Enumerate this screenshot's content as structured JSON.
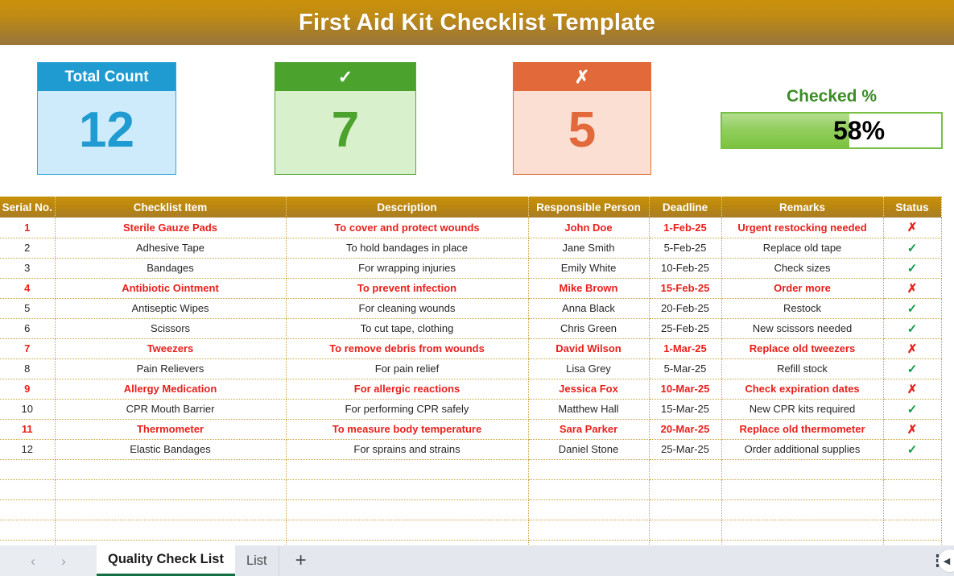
{
  "document": {
    "title": "First Aid Kit Checklist Template"
  },
  "kpis": [
    {
      "id": "total",
      "header_label": "Total Count",
      "header_icon": "",
      "value": "12",
      "accent": "#1f9bd1",
      "body_bg": "#cdebfa"
    },
    {
      "id": "checked",
      "header_label": "✓",
      "header_icon": "check-icon",
      "value": "7",
      "accent": "#4ba32e",
      "body_bg": "#d9f0cd"
    },
    {
      "id": "unchecked",
      "header_label": "✗",
      "header_icon": "cross-icon",
      "value": "5",
      "accent": "#e2693a",
      "body_bg": "#fbdfd2"
    }
  ],
  "gauge": {
    "label": "Checked %",
    "value_text": "58%",
    "percent": 58,
    "accent": "#77c043",
    "label_color": "#3d8b28"
  },
  "table": {
    "columns": [
      "Serial No.",
      "Checklist Item",
      "Description",
      "Responsible Person",
      "Deadline",
      "Remarks",
      "Status"
    ],
    "header_bg": "#c9910b",
    "alert_color": "#e8201c",
    "ok_color": "#0f9d49",
    "rows": [
      {
        "serial": "1",
        "item": "Sterile Gauze Pads",
        "description": "To cover and protect wounds",
        "person": "John Doe",
        "deadline": "1-Feb-25",
        "remarks": "Urgent restocking needed",
        "status": "✗",
        "alert": true
      },
      {
        "serial": "2",
        "item": "Adhesive Tape",
        "description": "To hold bandages in place",
        "person": "Jane Smith",
        "deadline": "5-Feb-25",
        "remarks": "Replace old tape",
        "status": "✓",
        "alert": false
      },
      {
        "serial": "3",
        "item": "Bandages",
        "description": "For wrapping injuries",
        "person": "Emily White",
        "deadline": "10-Feb-25",
        "remarks": "Check sizes",
        "status": "✓",
        "alert": false
      },
      {
        "serial": "4",
        "item": "Antibiotic Ointment",
        "description": "To prevent infection",
        "person": "Mike Brown",
        "deadline": "15-Feb-25",
        "remarks": "Order more",
        "status": "✗",
        "alert": true
      },
      {
        "serial": "5",
        "item": "Antiseptic Wipes",
        "description": "For cleaning wounds",
        "person": "Anna Black",
        "deadline": "20-Feb-25",
        "remarks": "Restock",
        "status": "✓",
        "alert": false
      },
      {
        "serial": "6",
        "item": "Scissors",
        "description": "To cut tape, clothing",
        "person": "Chris Green",
        "deadline": "25-Feb-25",
        "remarks": "New scissors needed",
        "status": "✓",
        "alert": false
      },
      {
        "serial": "7",
        "item": "Tweezers",
        "description": "To remove debris from wounds",
        "person": "David Wilson",
        "deadline": "1-Mar-25",
        "remarks": "Replace old tweezers",
        "status": "✗",
        "alert": true
      },
      {
        "serial": "8",
        "item": "Pain Relievers",
        "description": "For pain relief",
        "person": "Lisa Grey",
        "deadline": "5-Mar-25",
        "remarks": "Refill stock",
        "status": "✓",
        "alert": false
      },
      {
        "serial": "9",
        "item": "Allergy Medication",
        "description": "For allergic reactions",
        "person": "Jessica Fox",
        "deadline": "10-Mar-25",
        "remarks": "Check expiration dates",
        "status": "✗",
        "alert": true
      },
      {
        "serial": "10",
        "item": "CPR Mouth Barrier",
        "description": "For performing CPR safely",
        "person": "Matthew Hall",
        "deadline": "15-Mar-25",
        "remarks": "New CPR kits required",
        "status": "✓",
        "alert": false
      },
      {
        "serial": "11",
        "item": "Thermometer",
        "description": "To measure body temperature",
        "person": "Sara Parker",
        "deadline": "20-Mar-25",
        "remarks": "Replace old thermometer",
        "status": "✗",
        "alert": true
      },
      {
        "serial": "12",
        "item": "Elastic Bandages",
        "description": "For sprains and strains",
        "person": "Daniel Stone",
        "deadline": "25-Mar-25",
        "remarks": "Order additional supplies",
        "status": "✓",
        "alert": false
      }
    ],
    "empty_row_count": 5
  },
  "tabbar": {
    "prev_label": "‹",
    "next_label": "›",
    "tabs": [
      {
        "label": "Quality Check List",
        "active": true
      },
      {
        "label": "List",
        "active": false
      }
    ],
    "add_label": "+",
    "menu_label": "more-options"
  }
}
